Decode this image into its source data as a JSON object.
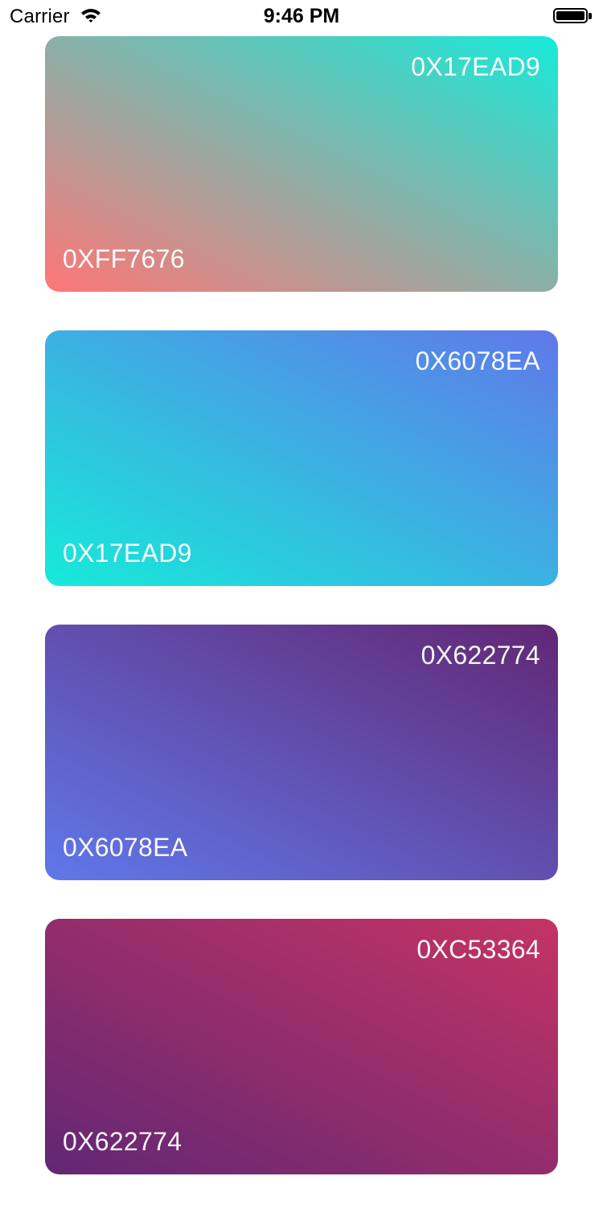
{
  "status_bar": {
    "carrier": "Carrier",
    "time": "9:46 PM",
    "wifi_icon": "wifi-icon",
    "battery_icon": "battery-full-icon"
  },
  "cards": [
    {
      "start_label": "0XFF7676",
      "end_label": "0X17EAD9",
      "start_color": "#FF7676",
      "end_color": "#17EAD9"
    },
    {
      "start_label": "0X17EAD9",
      "end_label": "0X6078EA",
      "start_color": "#17EAD9",
      "end_color": "#6078EA"
    },
    {
      "start_label": "0X6078EA",
      "end_label": "0X622774",
      "start_color": "#6078EA",
      "end_color": "#622774"
    },
    {
      "start_label": "0X622774",
      "end_label": "0XC53364",
      "start_color": "#622774",
      "end_color": "#C53364"
    }
  ]
}
